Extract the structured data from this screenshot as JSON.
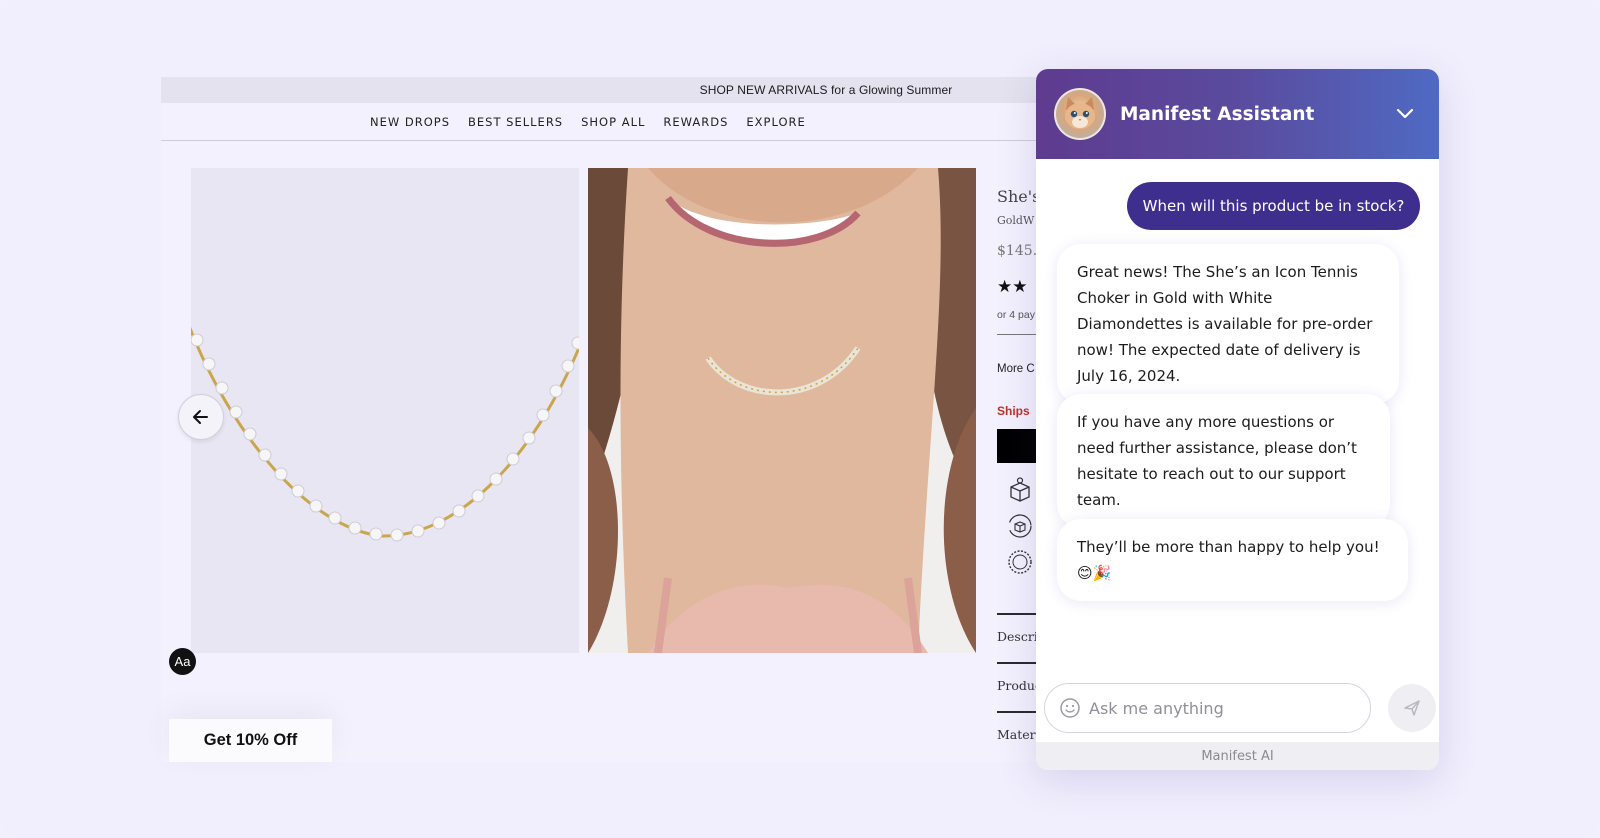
{
  "store": {
    "promo_text": "SHOP NEW ARRIVALS for a Glowing Summer",
    "nav": [
      {
        "label": "NEW DROPS"
      },
      {
        "label": "BEST SELLERS"
      },
      {
        "label": "SHOP ALL"
      },
      {
        "label": "REWARDS"
      },
      {
        "label": "EXPLORE"
      }
    ],
    "product": {
      "title_partial": "She's",
      "subtitle_partial": "GoldW",
      "price_partial": "$145.0",
      "stars_partial": "★★",
      "installments_partial": "or 4 pay",
      "more_partial": "More C",
      "ships_partial": "Ships",
      "accordion": [
        {
          "label": "Descri"
        },
        {
          "label": "Produc"
        },
        {
          "label": "Materi"
        }
      ]
    },
    "font_badge": "Aa",
    "discount_tab": "Get 10% Off"
  },
  "chat": {
    "title": "Manifest Assistant",
    "messages": {
      "user": "When will this product be in stock?",
      "bot_1": "Great news! The She’s an Icon Tennis Choker in Gold with White Diamondettes is available for pre-order now! The expected date of delivery is July 16, 2024.",
      "bot_2": "If you have any more questions or need further assistance, please don’t hesitate to reach out to our support team.",
      "bot_3": "They’ll be more than happy to help you! 😊🎉"
    },
    "input_placeholder": "Ask me anything",
    "footer": "Manifest AI",
    "colors": {
      "header_start": "#5e3b8f",
      "header_end": "#4f6ac3",
      "user_bubble": "#3e2f8f"
    }
  }
}
